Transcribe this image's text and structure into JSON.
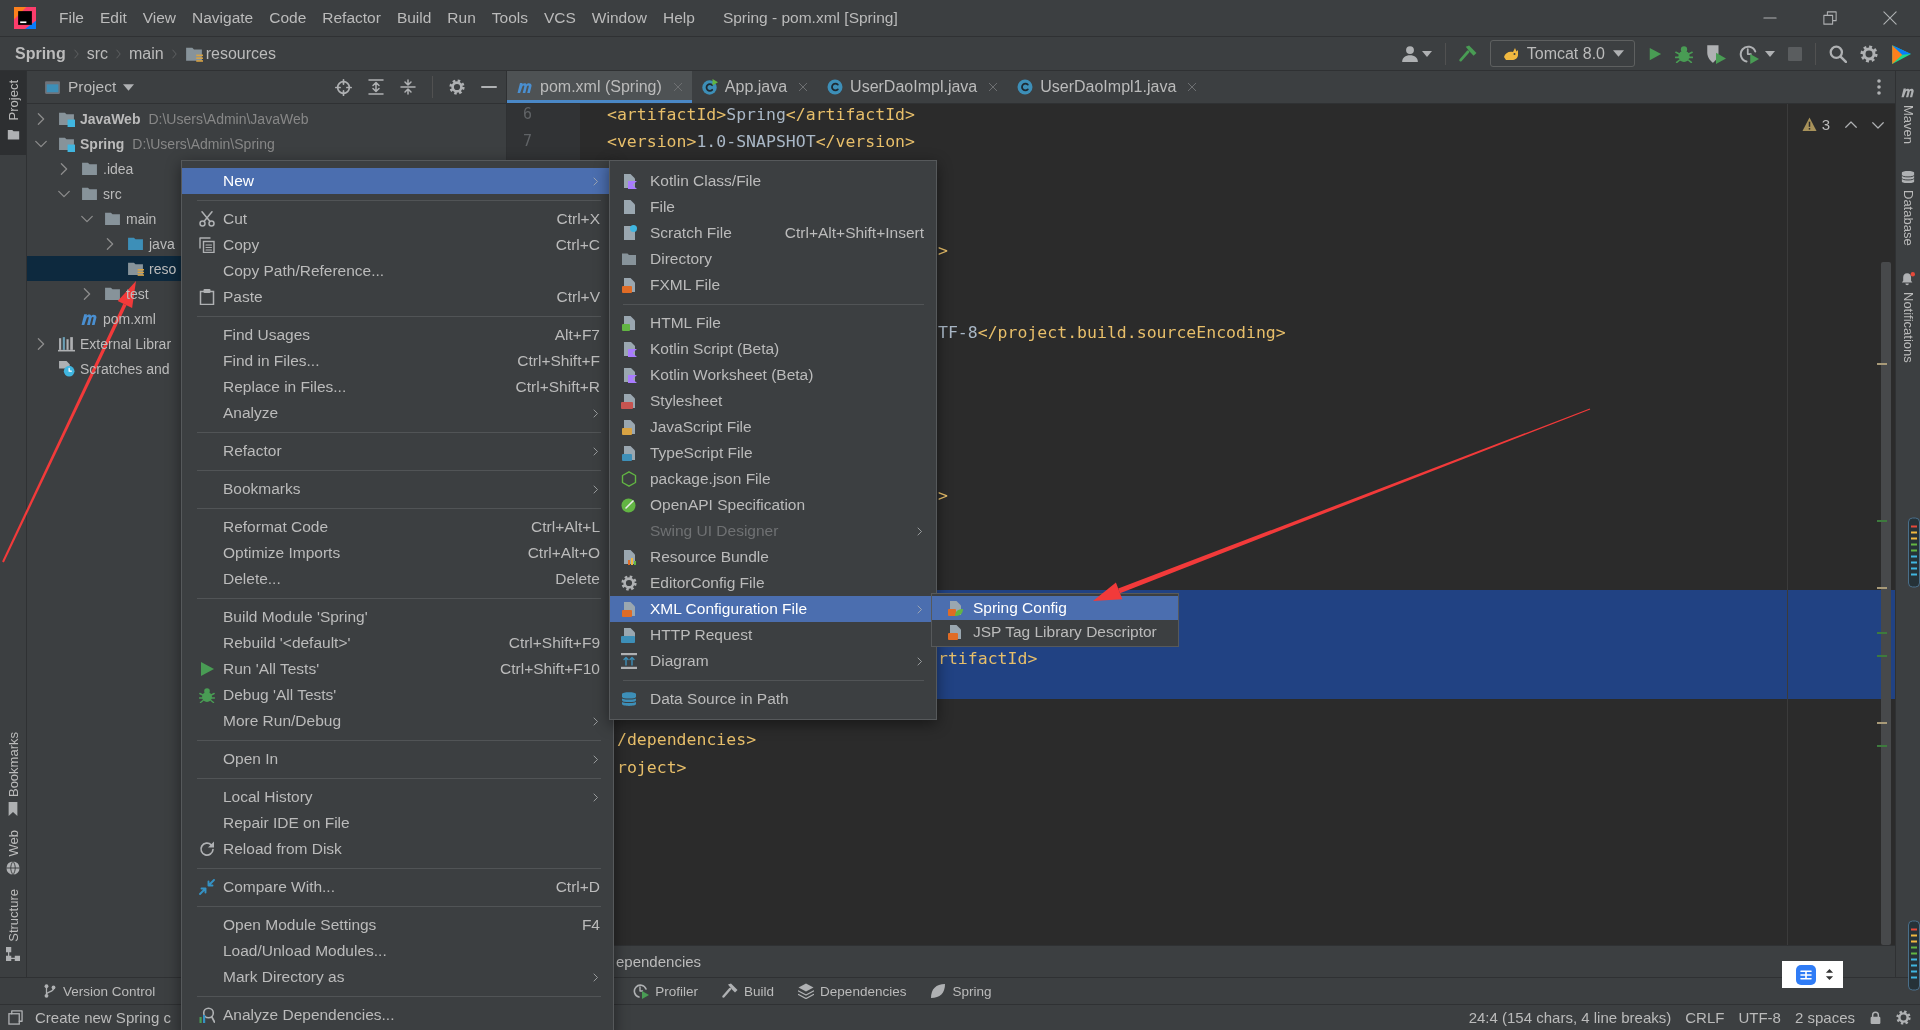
{
  "menu_bar": {
    "items": [
      "File",
      "Edit",
      "View",
      "Navigate",
      "Code",
      "Refactor",
      "Build",
      "Run",
      "Tools",
      "VCS",
      "Window",
      "Help"
    ],
    "title": "Spring - pom.xml [Spring]"
  },
  "nav_bar": {
    "breadcrumbs": [
      {
        "label": "Spring",
        "kind": "project"
      },
      {
        "label": "src",
        "kind": "plain"
      },
      {
        "label": "main",
        "kind": "plain"
      },
      {
        "label": "resources",
        "kind": "resources"
      }
    ],
    "run_configuration": "Tomcat 8.0"
  },
  "left_strip": {
    "top": [
      {
        "label": "Project",
        "kind": "project",
        "selected": true
      }
    ],
    "bottom": [
      {
        "label": "Bookmarks",
        "kind": "bookmarks",
        "selected": false
      },
      {
        "label": "Web",
        "kind": "web",
        "selected": false
      },
      {
        "label": "Structure",
        "kind": "structure",
        "selected": false
      }
    ]
  },
  "project_panel": {
    "title": "Project",
    "tree": [
      {
        "label": "JavaWeb",
        "detail": "D:\\Users\\Admin\\JavaWeb",
        "kind": "module",
        "expanded": false,
        "selected": false
      },
      {
        "label": "Spring",
        "detail": "D:\\Users\\Admin\\Spring",
        "kind": "module",
        "expanded": true,
        "selected": false,
        "children": [
          {
            "label": ".idea",
            "kind": "folder",
            "expanded": false,
            "selected": false
          },
          {
            "label": "src",
            "kind": "folder",
            "expanded": true,
            "selected": false,
            "children": [
              {
                "label": "main",
                "kind": "folder",
                "expanded": true,
                "selected": false,
                "children": [
                  {
                    "label": "java",
                    "kind": "source-folder",
                    "expanded": false,
                    "selected": false
                  },
                  {
                    "label": "reso",
                    "kind": "resources-folder",
                    "selected": true
                  }
                ]
              },
              {
                "label": "test",
                "kind": "folder",
                "expanded": false,
                "selected": false
              }
            ]
          },
          {
            "label": "pom.xml",
            "kind": "maven-file",
            "selected": false
          }
        ]
      },
      {
        "label": "External Librar",
        "kind": "libraries",
        "expanded": false,
        "selected": false
      },
      {
        "label": "Scratches and",
        "kind": "scratches",
        "selected": false
      }
    ]
  },
  "tabs": [
    {
      "label": "pom.xml (Spring)",
      "kind": "maven",
      "selected": true
    },
    {
      "label": "App.java",
      "kind": "runnable-class",
      "selected": false
    },
    {
      "label": "UserDaoImpl.java",
      "kind": "class",
      "selected": false
    },
    {
      "label": "UserDaoImpl1.java",
      "kind": "class",
      "selected": false
    }
  ],
  "editor": {
    "problems": "3",
    "lines": [
      {
        "number": "6",
        "kind": "full",
        "selected": false,
        "parts": [
          {
            "text": "<artifactId>",
            "kind": "tag"
          },
          {
            "text": "Spring",
            "kind": "value"
          },
          {
            "text": "</artifactId>",
            "kind": "tag"
          }
        ]
      },
      {
        "number": "7",
        "kind": "full",
        "selected": false,
        "parts": [
          {
            "text": "<version>",
            "kind": "tag"
          },
          {
            "text": "1.0-SNAPSHOT",
            "kind": "value"
          },
          {
            "text": "</version>",
            "kind": "tag"
          }
        ]
      },
      {
        "selected": false
      },
      {
        "selected": false
      },
      {
        "selected": false
      },
      {
        "kind": "after-submenu",
        "selected": false,
        "parts": [
          {
            "text": ">",
            "kind": "tag"
          }
        ]
      },
      {
        "selected": false
      },
      {
        "selected": false
      },
      {
        "kind": "after-submenu",
        "selected": false,
        "parts": [
          {
            "text": "TF-8",
            "kind": "value"
          },
          {
            "text": "</project.build.sourceEncoding>",
            "kind": "tag"
          }
        ]
      },
      {
        "selected": false
      },
      {
        "selected": false
      },
      {
        "selected": false
      },
      {
        "selected": false
      },
      {
        "selected": false
      },
      {
        "kind": "after-submenu",
        "selected": false,
        "parts": [
          {
            "text": ">",
            "kind": "tag"
          }
        ]
      },
      {
        "selected": false
      },
      {
        "selected": false
      },
      {
        "selected": false
      },
      {
        "selected": true
      },
      {
        "selected": true
      },
      {
        "kind": "after-submenu",
        "selected": true,
        "parts": [
          {
            "text": "rtifactId>",
            "kind": "tag"
          }
        ]
      },
      {
        "selected": true
      },
      {
        "selected": false
      },
      {
        "kind": "after-menu",
        "selected": false,
        "parts": [
          {
            "text": "/dependencies>",
            "kind": "tag"
          }
        ]
      },
      {
        "kind": "after-menu",
        "selected": false,
        "parts": [
          {
            "text": "roject>",
            "kind": "tag"
          }
        ]
      }
    ]
  },
  "dependencies_panel": {
    "title": "ependencies"
  },
  "right_strip": [
    {
      "label": "Maven",
      "kind": "maven"
    },
    {
      "label": "Database",
      "kind": "database"
    },
    {
      "label": "Notifications",
      "kind": "notifications"
    }
  ],
  "tool_bar": {
    "left": [
      {
        "label": "Version Control",
        "kind": "vcs"
      }
    ],
    "right": [
      {
        "label": "Profiler",
        "kind": "profiler"
      },
      {
        "label": "Build",
        "kind": "build"
      },
      {
        "label": "Dependencies",
        "kind": "dependencies"
      },
      {
        "label": "Spring",
        "kind": "spring"
      }
    ]
  },
  "status_bar": {
    "message": "Create new Spring c",
    "position": "24:4 (154 chars, 4 line breaks)",
    "line_separator": "CRLF",
    "encoding": "UTF-8",
    "indent": "2 spaces"
  },
  "context_menu": {
    "items": [
      {
        "kind": "plain",
        "label": "New",
        "submenu": true,
        "selected": true
      },
      {
        "kind": "separator"
      },
      {
        "kind": "cut",
        "label": "Cut",
        "shortcut": "Ctrl+X",
        "submenu": false,
        "selected": false
      },
      {
        "kind": "copy",
        "label": "Copy",
        "shortcut": "Ctrl+C",
        "submenu": false,
        "selected": false
      },
      {
        "kind": "plain",
        "label": "Copy Path/Reference...",
        "submenu": false,
        "selected": false
      },
      {
        "kind": "paste",
        "label": "Paste",
        "shortcut": "Ctrl+V",
        "submenu": false,
        "selected": false
      },
      {
        "kind": "separator"
      },
      {
        "kind": "plain",
        "label": "Find Usages",
        "shortcut": "Alt+F7",
        "submenu": false,
        "selected": false
      },
      {
        "kind": "plain",
        "label": "Find in Files...",
        "shortcut": "Ctrl+Shift+F",
        "submenu": false,
        "selected": false
      },
      {
        "kind": "plain",
        "label": "Replace in Files...",
        "shortcut": "Ctrl+Shift+R",
        "submenu": false,
        "selected": false
      },
      {
        "kind": "plain",
        "label": "Analyze",
        "submenu": true,
        "selected": false
      },
      {
        "kind": "separator"
      },
      {
        "kind": "plain",
        "label": "Refactor",
        "submenu": true,
        "selected": false
      },
      {
        "kind": "separator"
      },
      {
        "kind": "plain",
        "label": "Bookmarks",
        "submenu": true,
        "selected": false
      },
      {
        "kind": "separator"
      },
      {
        "kind": "plain",
        "label": "Reformat Code",
        "shortcut": "Ctrl+Alt+L",
        "submenu": false,
        "selected": false
      },
      {
        "kind": "plain",
        "label": "Optimize Imports",
        "shortcut": "Ctrl+Alt+O",
        "submenu": false,
        "selected": false
      },
      {
        "kind": "plain",
        "label": "Delete...",
        "shortcut": "Delete",
        "submenu": false,
        "selected": false
      },
      {
        "kind": "separator"
      },
      {
        "kind": "plain",
        "label": "Build Module 'Spring'",
        "submenu": false,
        "selected": false
      },
      {
        "kind": "plain",
        "label": "Rebuild '<default>'",
        "shortcut": "Ctrl+Shift+F9",
        "submenu": false,
        "selected": false
      },
      {
        "kind": "run",
        "label": "Run 'All Tests'",
        "shortcut": "Ctrl+Shift+F10",
        "submenu": false,
        "selected": false
      },
      {
        "kind": "debug",
        "label": "Debug 'All Tests'",
        "submenu": false,
        "selected": false
      },
      {
        "kind": "plain",
        "label": "More Run/Debug",
        "submenu": true,
        "selected": false
      },
      {
        "kind": "separator"
      },
      {
        "kind": "plain",
        "label": "Open In",
        "submenu": true,
        "selected": false
      },
      {
        "kind": "separator"
      },
      {
        "kind": "plain",
        "label": "Local History",
        "submenu": true,
        "selected": false
      },
      {
        "kind": "plain",
        "label": "Repair IDE on File",
        "submenu": false,
        "selected": false
      },
      {
        "kind": "reload",
        "label": "Reload from Disk",
        "submenu": false,
        "selected": false
      },
      {
        "kind": "separator"
      },
      {
        "kind": "compare",
        "label": "Compare With...",
        "shortcut": "Ctrl+D",
        "submenu": false,
        "selected": false
      },
      {
        "kind": "separator"
      },
      {
        "kind": "plain",
        "label": "Open Module Settings",
        "shortcut": "F4",
        "submenu": false,
        "selected": false
      },
      {
        "kind": "plain",
        "label": "Load/Unload Modules...",
        "submenu": false,
        "selected": false
      },
      {
        "kind": "plain",
        "label": "Mark Directory as",
        "submenu": true,
        "selected": false
      },
      {
        "kind": "separator"
      },
      {
        "kind": "analyze",
        "label": "Analyze Dependencies...",
        "submenu": false,
        "selected": false
      }
    ]
  },
  "new_submenu": {
    "items": [
      {
        "kind": "kotlin",
        "label": "Kotlin Class/File",
        "submenu": false,
        "selected": false,
        "disabled": false
      },
      {
        "kind": "file",
        "label": "File",
        "submenu": false,
        "selected": false,
        "disabled": false
      },
      {
        "kind": "scratch",
        "label": "Scratch File",
        "shortcut": "Ctrl+Alt+Shift+Insert",
        "submenu": false,
        "selected": false,
        "disabled": false
      },
      {
        "kind": "folder",
        "label": "Directory",
        "submenu": false,
        "selected": false,
        "disabled": false
      },
      {
        "kind": "xml",
        "label": "FXML File",
        "submenu": false,
        "selected": false,
        "disabled": false
      },
      {
        "kind": "separator"
      },
      {
        "kind": "html",
        "label": "HTML File",
        "submenu": false,
        "selected": false,
        "disabled": false
      },
      {
        "kind": "kotlin-script",
        "label": "Kotlin Script (Beta)",
        "submenu": false,
        "selected": false,
        "disabled": false
      },
      {
        "kind": "kotlin-script",
        "label": "Kotlin Worksheet (Beta)",
        "submenu": false,
        "selected": false,
        "disabled": false
      },
      {
        "kind": "css",
        "label": "Stylesheet",
        "submenu": false,
        "selected": false,
        "disabled": false
      },
      {
        "kind": "js",
        "label": "JavaScript File",
        "submenu": false,
        "selected": false,
        "disabled": false
      },
      {
        "kind": "ts",
        "label": "TypeScript File",
        "submenu": false,
        "selected": false,
        "disabled": false
      },
      {
        "kind": "node",
        "label": "package.json File",
        "submenu": false,
        "selected": false,
        "disabled": false
      },
      {
        "kind": "openapi",
        "label": "OpenAPI Specification",
        "submenu": false,
        "selected": false,
        "disabled": false
      },
      {
        "kind": "plain",
        "label": "Swing UI Designer",
        "submenu": true,
        "selected": false,
        "disabled": true
      },
      {
        "kind": "bundle",
        "label": "Resource Bundle",
        "submenu": false,
        "selected": false,
        "disabled": false
      },
      {
        "kind": "editorconfig",
        "label": "EditorConfig File",
        "submenu": false,
        "selected": false,
        "disabled": false
      },
      {
        "kind": "xml",
        "label": "XML Configuration File",
        "submenu": true,
        "selected": true,
        "disabled": false
      },
      {
        "kind": "api",
        "label": "HTTP Request",
        "submenu": false,
        "selected": false,
        "disabled": false
      },
      {
        "kind": "diagram",
        "label": "Diagram",
        "submenu": true,
        "selected": false,
        "disabled": false
      },
      {
        "kind": "separator"
      },
      {
        "kind": "database",
        "label": "Data Source in Path",
        "submenu": false,
        "selected": false,
        "disabled": false
      }
    ]
  },
  "xml_submenu": {
    "items": [
      {
        "kind": "spring-xml",
        "label": "Spring Config",
        "submenu": false,
        "selected": true
      },
      {
        "kind": "xml",
        "label": "JSP Tag Library Descriptor",
        "submenu": false,
        "selected": false
      }
    ]
  }
}
